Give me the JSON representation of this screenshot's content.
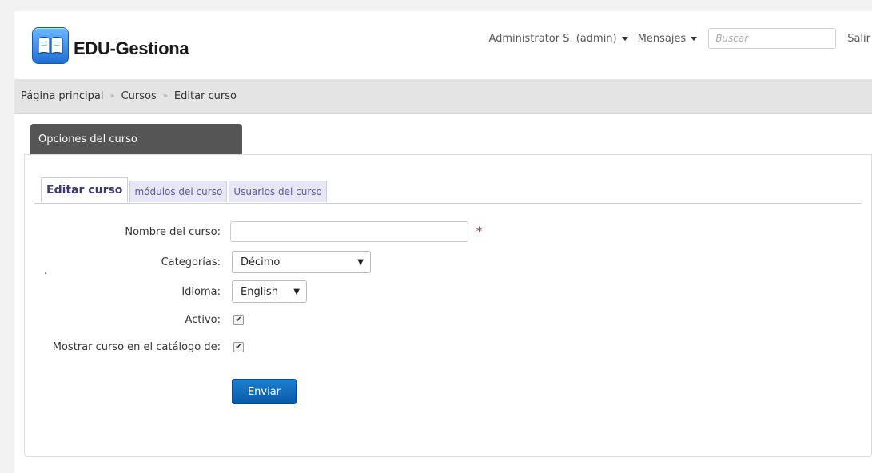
{
  "header": {
    "logo_text": "EDU-Gestiona",
    "user_menu": "Administrator S. (admin)",
    "messages_menu": "Mensajes",
    "search_placeholder": "Buscar",
    "logout": "Salir"
  },
  "breadcrumb": {
    "items": [
      "Página principal",
      "Cursos",
      "Editar curso"
    ],
    "separator": "»"
  },
  "block": {
    "title": "Opciones del curso"
  },
  "tabs": [
    {
      "label": "Editar curso",
      "active": true
    },
    {
      "label": "módulos del curso",
      "active": false
    },
    {
      "label": "Usuarios del curso",
      "active": false
    }
  ],
  "form": {
    "course_name_label": "Nombre del curso:",
    "course_name_value": "",
    "required_mark": "*",
    "categories_label": "Categorías:",
    "categories_value": "Décimo",
    "language_label": "Idioma:",
    "language_value": "English",
    "active_label": "Activo:",
    "active_checked": true,
    "catalog_label": "Mostrar curso en el catálogo de:",
    "catalog_checked": true,
    "submit_label": "Enviar",
    "stray_text": "."
  },
  "colors": {
    "breadcrumb_bg": "#e4e4e4",
    "block_header_bg": "#555555",
    "button_blue": "#0b5aa6",
    "tab_bg": "#e6e6f4",
    "required": "#cc0000"
  },
  "icons": {
    "logo": "open-book-icon",
    "dropdown": "caret-down-icon",
    "check": "checkmark-icon"
  }
}
